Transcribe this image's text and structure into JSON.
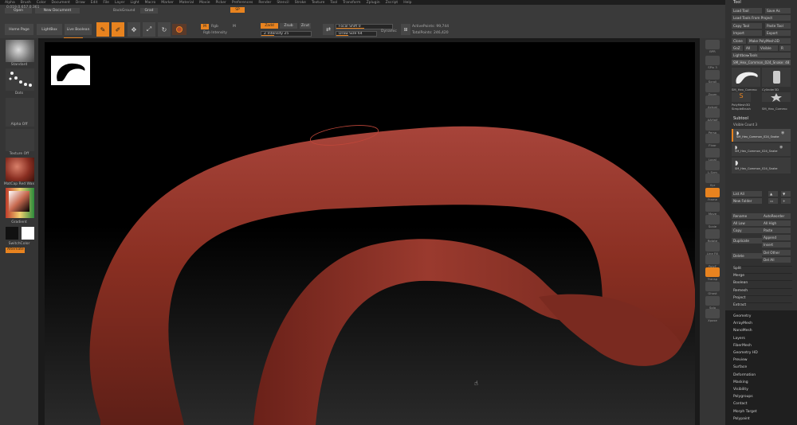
{
  "menu": [
    "Alpha",
    "Brush",
    "Color",
    "Document",
    "Draw",
    "Edit",
    "File",
    "Layer",
    "Light",
    "Macro",
    "Marker",
    "Material",
    "Movie",
    "Picker",
    "Preferences",
    "Render",
    "Stencil",
    "Stroke",
    "Texture",
    "Tool",
    "Transform",
    "Zplugin",
    "Zscript",
    "Help"
  ],
  "topbar": {
    "coords": "0.019,0.657,0.361",
    "open": "Open",
    "new_document": "New Document",
    "gradient_label": "BackGround",
    "gradient_toggle": "Grad",
    "sp_button": "SP",
    "home_page": "Home Page",
    "lightbox": "LightBox",
    "live_boolean": "Live Boolean",
    "edit": "Edit",
    "draw": "Draw",
    "move": "Move",
    "scale": "Scale",
    "rotate": "Rotate",
    "mrgb": "Mrgb",
    "rgb": "Rgb",
    "m": "M",
    "rgb_intensity": "Rgb Intensity",
    "zadd": "Zadd",
    "zsub": "Zsub",
    "zcut": "Zcut",
    "z_intensity": "Z Intensity 25",
    "focal_shift": "Focal Shift 0",
    "draw_size": "Draw Size 64",
    "dynamic": "Dynamic",
    "active_points": "ActivePoints: 99,744",
    "total_points": "TotalPoints: 246,420"
  },
  "leftshelf": {
    "brush_label": "Standard",
    "stroke_label": "Dots",
    "alpha_label": "Alpha Off",
    "texture_label": "Texture Off",
    "material_label": "MatCap Red Wax",
    "gradient_label": "Gradient",
    "switch_color": "SwitchColor",
    "alternate": "Alternate"
  },
  "rightshelf": [
    "BPR",
    "SPix 3",
    "Scroll",
    "Zoom",
    "Actual",
    "AAHalf",
    "Persp",
    "Floor",
    "Local",
    "L.Sym",
    "Xyz",
    "Frame",
    "Move",
    "Scale",
    "Rotate",
    "Line Fill",
    "PolyF",
    "Transp",
    "Ghost",
    "Solo",
    "Xpose"
  ],
  "tray": {
    "title": "Tool",
    "load_tool": "Load Tool",
    "save_as": "Save As",
    "load_from_project": "Load Tools From Project",
    "copy_tool": "Copy Tool",
    "paste_tool": "Paste Tool",
    "import": "Import",
    "export": "Export",
    "clone": "Clone",
    "make_polymesh": "Make PolyMesh3D",
    "goz": "GoZ",
    "all": "All",
    "visible": "Visible",
    "r": "R",
    "lightbox_tools": "Lightbox▸Tools",
    "current_tool": "SM_Hex_Common_024_Snake: 48",
    "tool_thumbs": [
      "SM_Hex_Commo",
      "Cylinder3D",
      "PolyMesh3D",
      "SimpleBrush",
      "SM_Hex_Commo"
    ],
    "subtool_header": "Subtool",
    "visible_count": "Visible Count 3",
    "subtools": [
      "SM_Hex_Common_024_Snake",
      "SM_Hex_Common_024_Snake",
      "SM_Hex_Common_024_Snake"
    ],
    "list_all": "List All",
    "new_folder": "New Folder",
    "rename": "Rename",
    "auto_reorder": "AutoReorder",
    "all_low": "All Low",
    "all_high": "All High",
    "copy": "Copy",
    "paste": "Paste",
    "duplicate": "Duplicate",
    "append": "Append",
    "insert": "Insert",
    "delete": "Delete",
    "del_other": "Del Other",
    "del_all": "Del All",
    "sections": [
      "Split",
      "Merge",
      "Boolean",
      "Remesh",
      "Project",
      "Extract"
    ],
    "palettes": [
      "Geometry",
      "ArrayMesh",
      "NanoMesh",
      "Layers",
      "FiberMesh",
      "Geometry HD",
      "Preview",
      "Surface",
      "Deformation",
      "Masking",
      "Visibility",
      "Polygroups",
      "Contact",
      "Morph Target",
      "Polypaint"
    ]
  },
  "colors": {
    "accent": "#e8831f",
    "clay": "#8a2f22"
  }
}
